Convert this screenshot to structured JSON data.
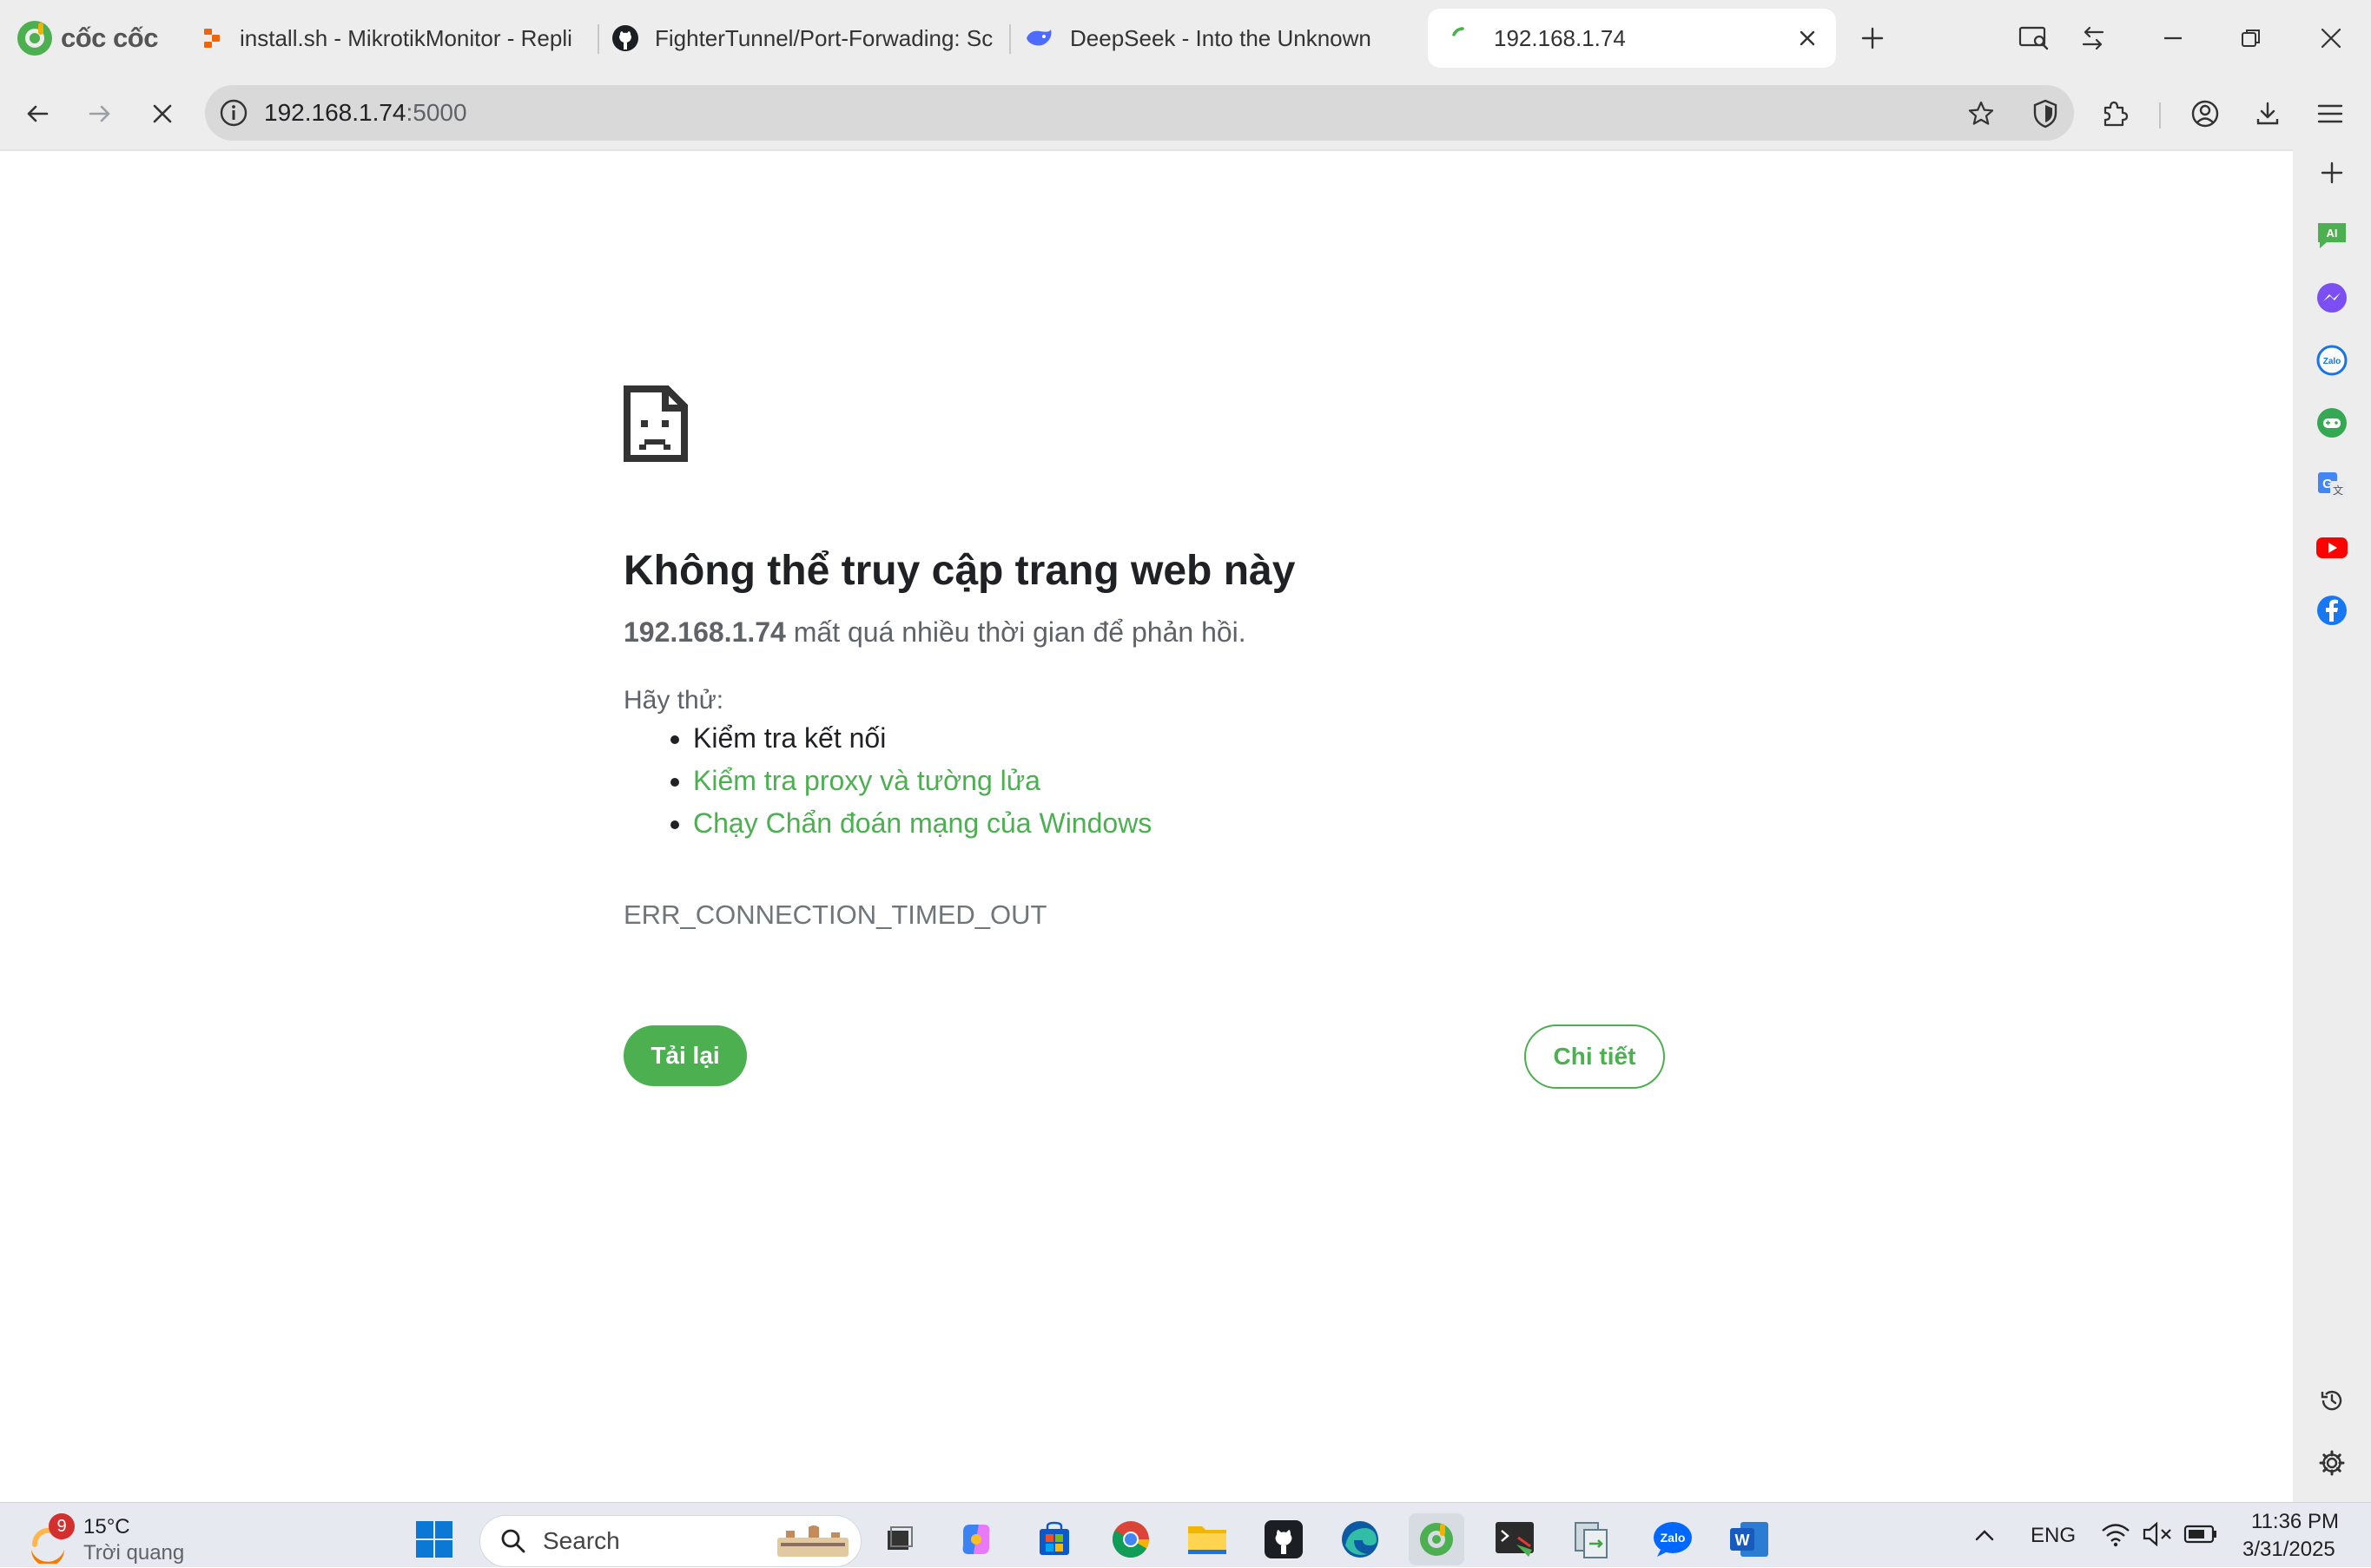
{
  "browser": {
    "brand": "cốc cốc",
    "tabs": [
      {
        "label": "install.sh - MikrotikMonitor - Repli",
        "icon": "replit-icon"
      },
      {
        "label": "FighterTunnel/Port-Forwading: Sc",
        "icon": "github-icon"
      },
      {
        "label": "DeepSeek - Into the Unknown",
        "icon": "deepseek-icon"
      },
      {
        "label": "192.168.1.74",
        "icon": "loading-icon",
        "active": true
      }
    ],
    "url_host": "192.168.1.74",
    "url_port": ":5000"
  },
  "error_page": {
    "title": "Không thể truy cập trang web này",
    "host": "192.168.1.74",
    "message": " mất quá nhiều thời gian để phản hồi.",
    "try_label": "Hãy thử:",
    "suggestions": [
      {
        "text": "Kiểm tra kết nối",
        "link": false
      },
      {
        "text": "Kiểm tra proxy và tường lửa",
        "link": true
      },
      {
        "text": "Chạy Chẩn đoán mạng của Windows",
        "link": true
      }
    ],
    "error_code": "ERR_CONNECTION_TIMED_OUT",
    "reload_label": "Tải lại",
    "details_label": "Chi tiết"
  },
  "taskbar": {
    "weather_temp": "15°C",
    "weather_desc": "Trời quang",
    "weather_badge": "9",
    "search_placeholder": "Search",
    "language": "ENG",
    "time": "11:36 PM",
    "date": "3/31/2025"
  },
  "colors": {
    "accent": "#4caf50",
    "chrome_bg": "#ededed",
    "omnibox_bg": "#d9d9d9"
  }
}
